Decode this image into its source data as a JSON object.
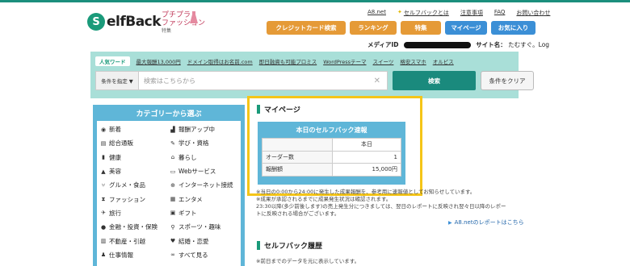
{
  "brand": {
    "logo_letter": "S",
    "logo_text": "elfBack",
    "sub_logo_line1": "プチプラ",
    "sub_logo_line2": "ファッション",
    "sub_logo_line3": "特集"
  },
  "top_links": [
    {
      "label": "A8.net"
    },
    {
      "label": "セルフバックとは"
    },
    {
      "label": "注意事項"
    },
    {
      "label": "FAQ"
    },
    {
      "label": "お問い合わせ"
    }
  ],
  "nav": {
    "credit": "クレジットカード検索",
    "ranking": "ランキング",
    "special": "特集",
    "mypage": "マイページ",
    "favorites": "お気に入り"
  },
  "media": {
    "id_label": "メディアID",
    "site_label": "サイト名：",
    "site_name": "たむすぐ。Log"
  },
  "search": {
    "popular_label": "人気ワード",
    "popular_words": [
      "最大報酬13,000円",
      "ドメイン取得はお名前.com",
      "即日融資も可能プロミス",
      "WordPressテーマ",
      "スイーツ",
      "格安スマホ",
      "オルビス"
    ],
    "condition_label": "条件を指定 ▼",
    "placeholder": "検索はこちらから",
    "search_button": "検索",
    "clear_button": "条件をクリア"
  },
  "categories": {
    "title": "カテゴリーから選ぶ",
    "items": [
      {
        "label": "新着",
        "icon": "eye-icon"
      },
      {
        "label": "報酬アップ中",
        "icon": "chart-icon"
      },
      {
        "label": "総合通販",
        "icon": "list-icon"
      },
      {
        "label": "学び・資格",
        "icon": "pencil-icon"
      },
      {
        "label": "健康",
        "icon": "bottle-icon"
      },
      {
        "label": "暮らし",
        "icon": "home-icon"
      },
      {
        "label": "美容",
        "icon": "cosmetic-icon"
      },
      {
        "label": "Webサービス",
        "icon": "monitor-icon"
      },
      {
        "label": "グルメ・食品",
        "icon": "fork-icon"
      },
      {
        "label": "インターネット接続",
        "icon": "globe-icon"
      },
      {
        "label": "ファッション",
        "icon": "dress-icon"
      },
      {
        "label": "エンタメ",
        "icon": "film-icon"
      },
      {
        "label": "旅行",
        "icon": "plane-icon"
      },
      {
        "label": "ギフト",
        "icon": "gift-icon"
      },
      {
        "label": "金融・投資・保険",
        "icon": "coins-icon"
      },
      {
        "label": "スポーツ・趣味",
        "icon": "bike-icon"
      },
      {
        "label": "不動産・引越",
        "icon": "building-icon"
      },
      {
        "label": "結婚・恋愛",
        "icon": "heart-icon"
      },
      {
        "label": "仕事情報",
        "icon": "person-icon"
      },
      {
        "label": "すべて見る",
        "icon": "binoculars-icon"
      }
    ]
  },
  "mypage": {
    "heading": "マイページ",
    "report_title": "本日のセルフバック速報",
    "col_header": "本日",
    "rows": [
      {
        "label": "オーダー数",
        "value": "1"
      },
      {
        "label": "報酬額",
        "value": "15,000円"
      }
    ],
    "note_line1": "※当日の0:00から24:00に発生した成果報酬を、参考用に速報値としてお知らせしています。",
    "note_line2": "※成果が承認されるまでに成果発生状況は確認されます。",
    "note_line3": "23:30以降(多少前後します)の売上発生分につきましては、翌日のレポートに反映され翌々日以降のレポー",
    "note_line4": "トに反映される場合がございます。",
    "a8_link": "A8.netのレポートはこちら"
  },
  "history": {
    "heading": "セルフバック履歴",
    "note": "※前日までのデータを元に表示しています。"
  },
  "colors": {
    "brand_green": "#1a9a7a",
    "nav_orange": "#e59a37",
    "nav_blue": "#3b8fd6",
    "panel_teal": "#a9dfd8",
    "category_blue": "#5fb6d8",
    "highlight_yellow": "#f5c518"
  }
}
